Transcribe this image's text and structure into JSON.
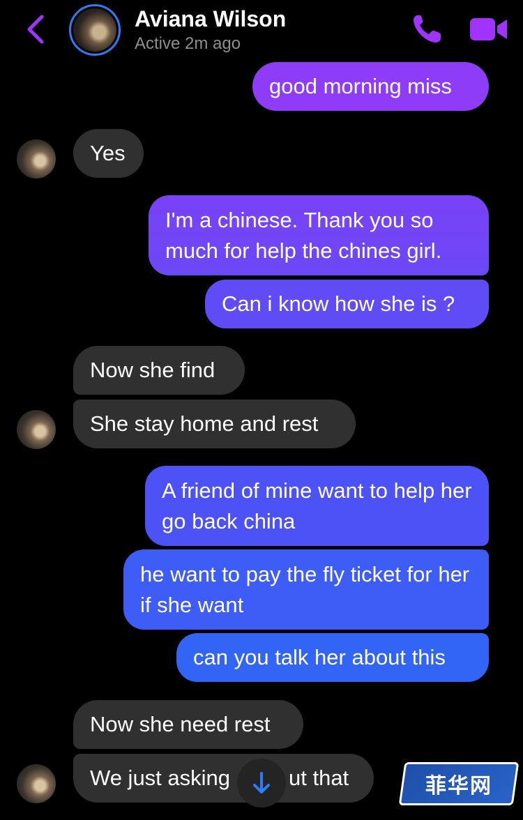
{
  "header": {
    "contact_name": "Aviana Wilson",
    "status": "Active 2m ago"
  },
  "messages": [
    {
      "from": "me",
      "text": "good morning miss"
    },
    {
      "from": "them",
      "text": "Yes"
    },
    {
      "from": "me",
      "text": "I'm a chinese. Thank you so much for help the chines girl."
    },
    {
      "from": "me",
      "text": "Can i know how she is ?"
    },
    {
      "from": "them",
      "text": "Now she find"
    },
    {
      "from": "them",
      "text": "She stay home and rest"
    },
    {
      "from": "me",
      "text": "A friend of mine want to help her go back china"
    },
    {
      "from": "me",
      "text": "he want to pay the fly ticket for her if she want"
    },
    {
      "from": "me",
      "text": "can you talk her about this"
    },
    {
      "from": "them",
      "text": "Now she need rest"
    },
    {
      "from": "them",
      "text": "We just asking about that"
    }
  ],
  "visible_partial_text": {
    "last_message_left": "We just asking",
    "last_message_right": "ut that"
  },
  "watermark": {
    "text": "菲华网"
  },
  "colors": {
    "accent": "#a033ff",
    "bubble_in": "#303030",
    "bubble_out_top": "#8a3cf7",
    "bubble_out_bottom": "#2f6af6",
    "background": "#000000"
  },
  "icons": [
    "back-chevron-icon",
    "phone-icon",
    "video-camera-icon",
    "arrow-down-icon"
  ]
}
